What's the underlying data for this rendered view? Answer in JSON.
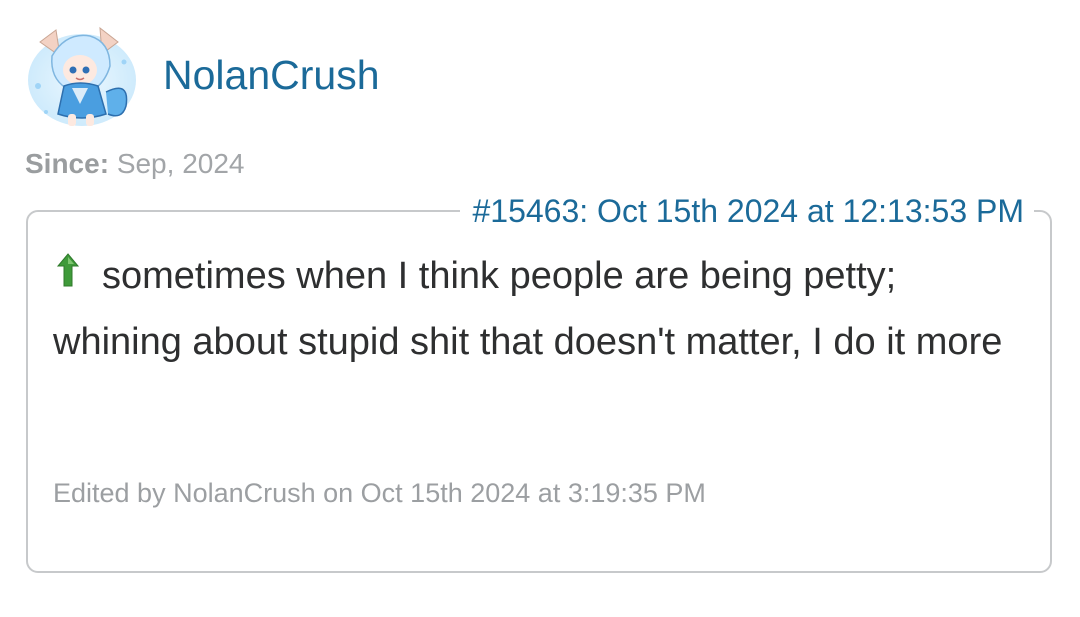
{
  "user": {
    "name": "NolanCrush",
    "avatar_icon": "anime-character-avatar-icon",
    "since_label": "Since:",
    "since_value": "Sep, 2024"
  },
  "post": {
    "number_header": "#15463: Oct 15th 2024 at 12:13:53 PM",
    "vote_icon": "green-up-arrow-icon",
    "body_text": "sometimes when I think people are being petty; whining about stupid shit that doesn't matter, I do it more",
    "edited_note": "Edited by NolanCrush on Oct 15th 2024 at 3:19:35 PM"
  },
  "colors": {
    "link": "#1b6a99",
    "body_text": "#2e2f30",
    "muted": "#9c9fa2",
    "border": "#c7c9cb",
    "up_arrow": "#3f9a3a"
  }
}
